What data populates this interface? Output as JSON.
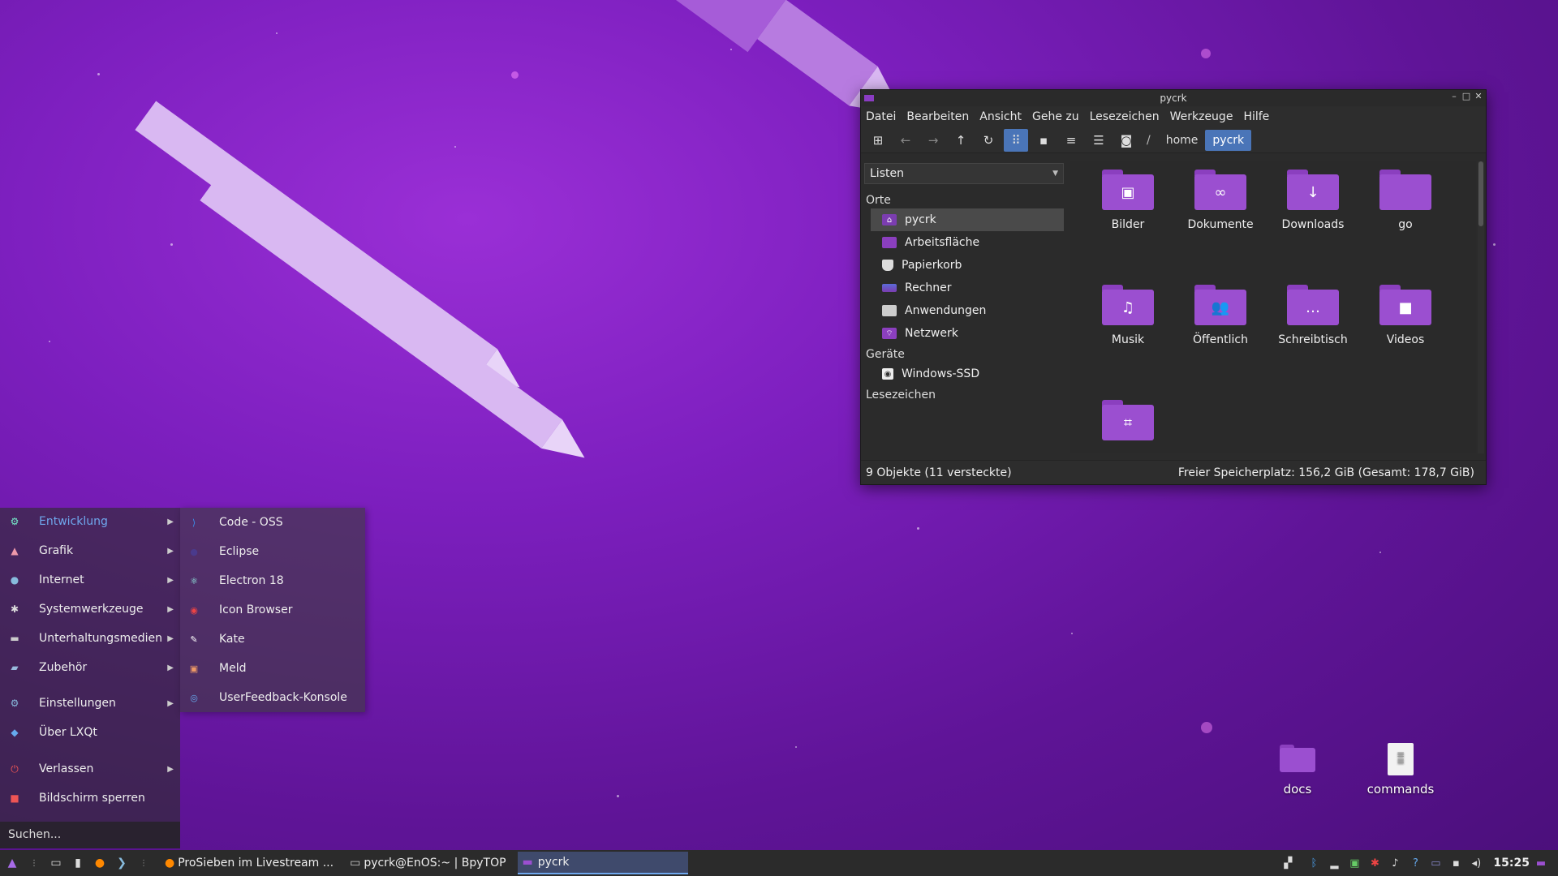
{
  "colors": {
    "accent": "#4a75b8",
    "folder": "#9b4fd0",
    "menu_active": "#6fa8ee",
    "background": "#6a1aa8"
  },
  "file_manager": {
    "title": "pycrk",
    "menu": [
      "Datei",
      "Bearbeiten",
      "Ansicht",
      "Gehe zu",
      "Lesezeichen",
      "Werkzeuge",
      "Hilfe"
    ],
    "breadcrumb_sep": "/",
    "breadcrumb": [
      "home",
      "pycrk"
    ],
    "side_mode": "Listen",
    "places_header": "Orte",
    "places": [
      {
        "label": "pycrk",
        "icon": "home-icon"
      },
      {
        "label": "Arbeitsfläche",
        "icon": "desktop-icon"
      },
      {
        "label": "Papierkorb",
        "icon": "trash-icon"
      },
      {
        "label": "Rechner",
        "icon": "computer-icon"
      },
      {
        "label": "Anwendungen",
        "icon": "applications-icon"
      },
      {
        "label": "Netzwerk",
        "icon": "network-icon"
      }
    ],
    "devices_header": "Geräte",
    "devices": [
      {
        "label": "Windows-SSD",
        "icon": "drive-icon"
      }
    ],
    "bookmarks_header": "Lesezeichen",
    "files": [
      {
        "label": "Bilder",
        "icon": "pictures-folder-icon",
        "glyph": "▣"
      },
      {
        "label": "Dokumente",
        "icon": "documents-folder-icon",
        "glyph": "∞"
      },
      {
        "label": "Downloads",
        "icon": "downloads-folder-icon",
        "glyph": "↓"
      },
      {
        "label": "go",
        "icon": "folder-icon",
        "glyph": ""
      },
      {
        "label": "Musik",
        "icon": "music-folder-icon",
        "glyph": "♫"
      },
      {
        "label": "Öffentlich",
        "icon": "public-folder-icon",
        "glyph": "👥"
      },
      {
        "label": "Schreibtisch",
        "icon": "desktop-folder-icon",
        "glyph": "…"
      },
      {
        "label": "Videos",
        "icon": "videos-folder-icon",
        "glyph": "■"
      },
      {
        "label": "",
        "icon": "templates-folder-icon",
        "glyph": "⌗"
      }
    ],
    "status_left": "9 Objekte (11 versteckte)",
    "status_right": "Freier Speicherplatz: 156,2 GiB (Gesamt: 178,7 GiB)"
  },
  "start_menu": {
    "items": [
      {
        "label": "Entwicklung",
        "icon": "development-icon",
        "submenu": true
      },
      {
        "label": "Grafik",
        "icon": "graphics-icon",
        "submenu": true
      },
      {
        "label": "Internet",
        "icon": "internet-icon",
        "submenu": true
      },
      {
        "label": "Systemwerkzeuge",
        "icon": "system-tools-icon",
        "submenu": true
      },
      {
        "label": "Unterhaltungsmedien",
        "icon": "multimedia-icon",
        "submenu": true
      },
      {
        "label": "Zubehör",
        "icon": "accessories-icon",
        "submenu": true
      },
      {
        "label": "Einstellungen",
        "icon": "settings-icon",
        "submenu": true
      },
      {
        "label": "Über LXQt",
        "icon": "about-icon",
        "submenu": false
      },
      {
        "label": "Verlassen",
        "icon": "leave-icon",
        "submenu": true
      },
      {
        "label": "Bildschirm sperren",
        "icon": "lock-screen-icon",
        "submenu": false
      }
    ],
    "search_placeholder": "Suchen...",
    "submenu_items": [
      {
        "label": "Code - OSS",
        "icon": "vscode-icon"
      },
      {
        "label": "Eclipse",
        "icon": "eclipse-icon"
      },
      {
        "label": "Electron 18",
        "icon": "electron-icon"
      },
      {
        "label": "Icon Browser",
        "icon": "icon-browser-icon"
      },
      {
        "label": "Kate",
        "icon": "kate-icon"
      },
      {
        "label": "Meld",
        "icon": "meld-icon"
      },
      {
        "label": "UserFeedback-Konsole",
        "icon": "userfeedback-icon"
      }
    ]
  },
  "desktop_icons": [
    {
      "label": "docs",
      "icon": "folder-icon"
    },
    {
      "label": "commands",
      "icon": "text-file-icon"
    }
  ],
  "taskbar": {
    "tasks": [
      {
        "label": "ProSieben im Livestream ...",
        "icon": "firefox-icon"
      },
      {
        "label": "pycrk@EnOS:~ | BpyTOP",
        "icon": "terminal-icon"
      },
      {
        "label": "pycrk",
        "icon": "file-manager-icon"
      }
    ],
    "clock": "15:25"
  }
}
